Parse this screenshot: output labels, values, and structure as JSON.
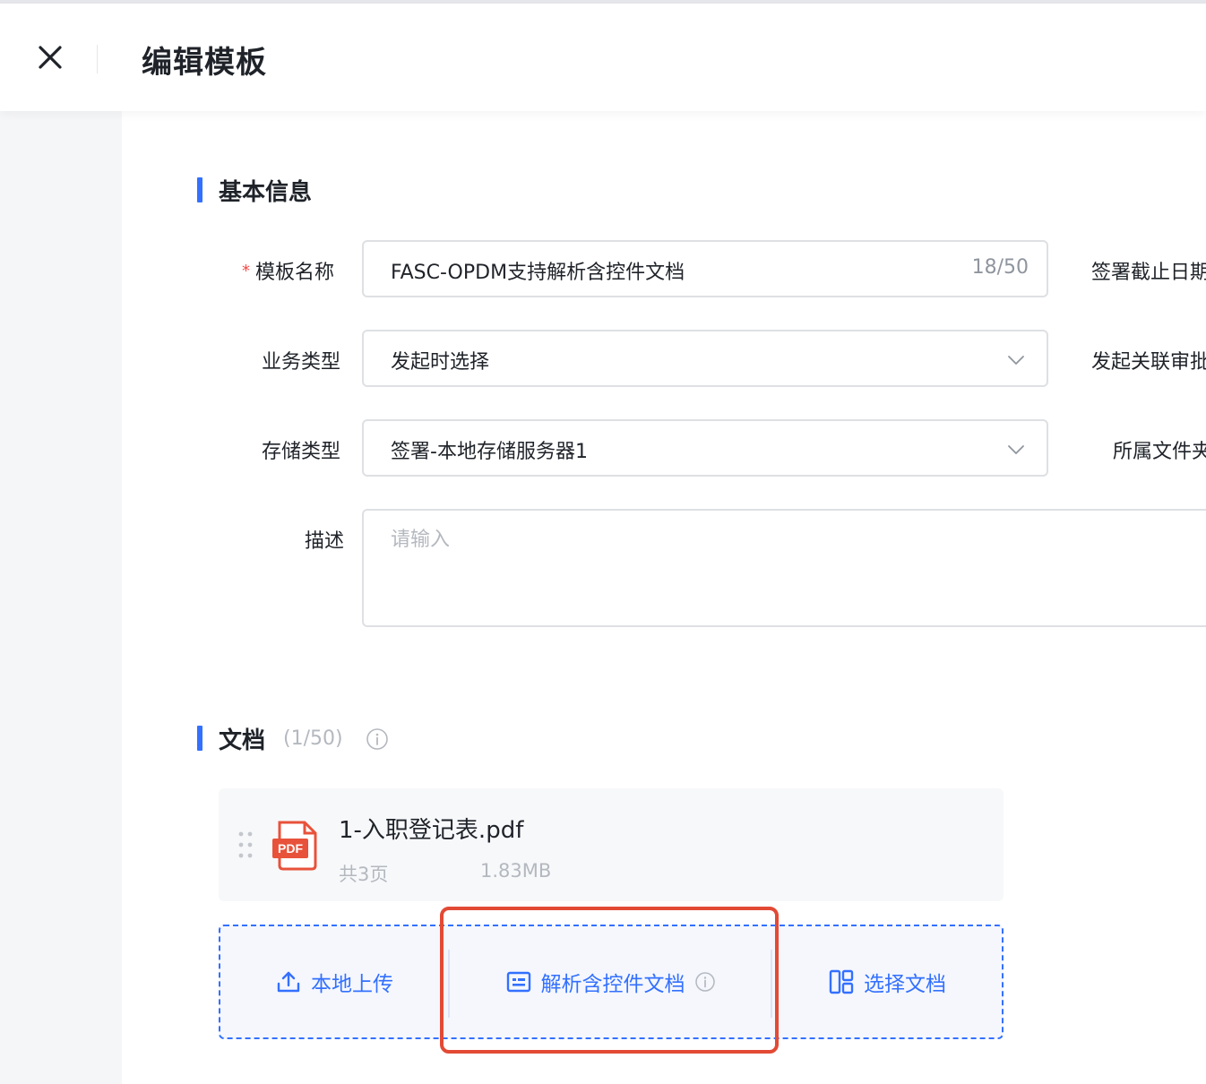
{
  "header": {
    "title": "编辑模板",
    "close_icon": "close-icon"
  },
  "basic_section": {
    "title": "基本信息"
  },
  "form": {
    "template_name": {
      "label": "模板名称",
      "required_mark": "*",
      "value": "FASC-OPDM支持解析含控件文档",
      "count": "18/50"
    },
    "business_type": {
      "label": "业务类型",
      "value": "发起时选择"
    },
    "storage_type": {
      "label": "存储类型",
      "value": "签署-本地存储服务器1"
    },
    "description": {
      "label": "描述",
      "placeholder": "请输入"
    },
    "right_labels": {
      "deadline": "签署截止日期",
      "approval": "发起关联审批",
      "folder": "所属文件夹"
    }
  },
  "docs_section": {
    "title": "文档",
    "count": "(1/50)"
  },
  "document": {
    "name": "1-入职登记表.pdf",
    "pages": "共3页",
    "size": "1.83MB",
    "type_badge": "PDF"
  },
  "upload_actions": {
    "local_upload": "本地上传",
    "parse_controls": "解析含控件文档",
    "select_doc": "选择文档"
  },
  "colors": {
    "accent": "#3370ff",
    "highlight": "#e24a35",
    "pdf": "#e8523a"
  }
}
